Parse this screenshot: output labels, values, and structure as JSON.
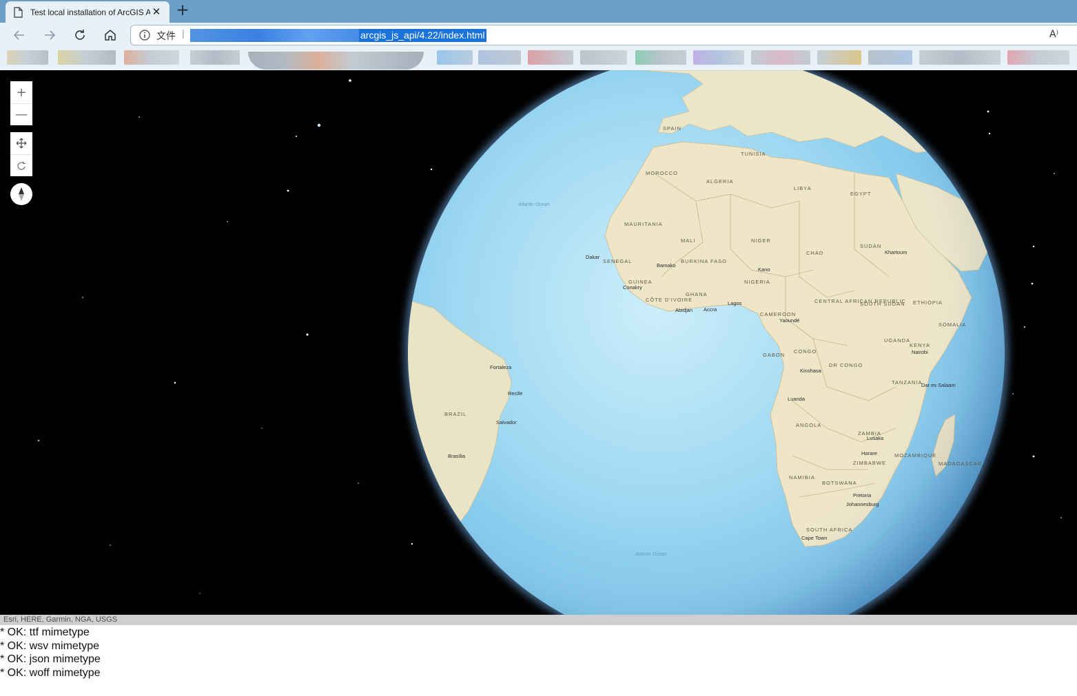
{
  "tab": {
    "title": "Test local installation of ArcGIS A",
    "close_glyph": "✕",
    "icon": "page-icon"
  },
  "newtab_glyph": "+",
  "toolbar": {
    "icons": [
      "back-arrow-icon",
      "forward-arrow-icon",
      "reload-icon",
      "home-icon"
    ]
  },
  "address_bar": {
    "scheme_label": "文件",
    "separator": "|",
    "url_visible": "arcgis_js_api/4.22/index.html",
    "read_aloud_label": "A⁾"
  },
  "map": {
    "zoom_in_glyph": "+",
    "zoom_out_glyph": "—",
    "icons": [
      "pan-icon",
      "rotate-icon",
      "compass-icon"
    ],
    "attribution": "Esri, HERE, Garmin, NGA, USGS",
    "labels": {
      "algeria": "ALGERIA",
      "libya": "LIBYA",
      "egypt": "EGYPT",
      "morocco": "MOROCCO",
      "mauritania": "MAURITANIA",
      "mali": "MALI",
      "niger": "NIGER",
      "chad": "CHAD",
      "sudan": "SUDAN",
      "senegal": "SENEGAL",
      "burkina": "BURKINA FASO",
      "nigeria": "NIGERIA",
      "ghana": "GHANA",
      "guinea": "GUINEA",
      "cotedivoire": "CÔTE D'IVOIRE",
      "cameroon": "CAMEROON",
      "car": "CENTRAL AFRICAN REPUBLIC",
      "southsudan": "SOUTH SUDAN",
      "ethiopia": "ETHIOPIA",
      "gabon": "GABON",
      "congo": "CONGO",
      "drcongo": "DR CONGO",
      "kenya": "KENYA",
      "uganda": "UGANDA",
      "tanzania": "TANZANIA",
      "angola": "ANGOLA",
      "zambia": "ZAMBIA",
      "zimbabwe": "ZIMBABWE",
      "namibia": "NAMIBIA",
      "botswana": "BOTSWANA",
      "southafrica": "SOUTH AFRICA",
      "mozambique": "MOZAMBIQUE",
      "madagascar": "MADAGASCAR",
      "brazil": "BRAZIL",
      "somalia": "SOMALIA",
      "dakar": "Dakar",
      "bamako": "Bamako",
      "kano": "Kano",
      "lagos": "Lagos",
      "accra": "Accra",
      "abidjan": "Abidjan",
      "conakry": "Conakry",
      "yaounde": "Yaoundé",
      "kinshasa": "Kinshasa",
      "luanda": "Luanda",
      "khartoum": "Khartoum",
      "nairobi": "Nairobi",
      "dar": "Dar es Salaam",
      "harare": "Harare",
      "lusaka": "Lusaka",
      "pretoria": "Pretoria",
      "joburg": "Johannesburg",
      "capetown": "Cape Town",
      "fortaleza": "Fortaleza",
      "recife": "Recife",
      "salvador": "Salvador",
      "brasilia": "Brasília",
      "atlantic_n": "Atlantic Ocean",
      "atlantic_s": "Atlantic Ocean",
      "spain": "SPAIN",
      "tunisia": "TUNISIA"
    }
  },
  "log_lines": [
    "* OK: ttf mimetype",
    "* OK: wsv mimetype",
    "* OK: json mimetype",
    "* OK: woff mimetype"
  ],
  "colors": {
    "tabstrip": "#6b9fc7",
    "toolbar": "#e9f1f8",
    "url_highlight": "#1a73d9",
    "space": "#000000",
    "ocean": "#8fd0ef",
    "land": "#efe6c8"
  }
}
